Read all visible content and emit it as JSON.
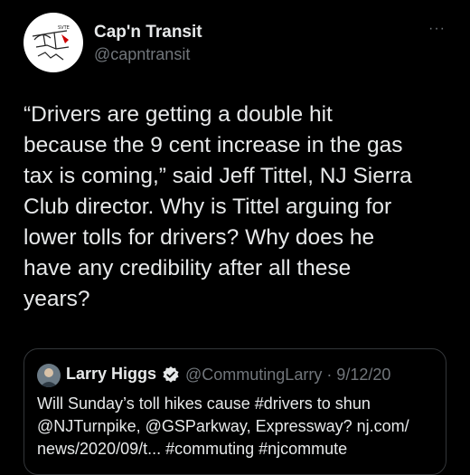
{
  "author": {
    "display_name": "Cap'n Transit",
    "handle": "@capntransit",
    "more_label": "···"
  },
  "tweet": {
    "text": "“Drivers are getting a double hit\nbecause the 9 cent increase in the gas\ntax is coming,” said Jeff Tittel, NJ Sierra\nClub director.  Why is Tittel arguing for\nlower tolls for drivers?  Why does he\nhave any credibility after all these\nyears?"
  },
  "quoted_tweet": {
    "display_name": "Larry Higgs",
    "handle_date": "@CommutingLarry · 9/12/20",
    "text": "Will Sunday’s  toll hikes cause #drivers to shun\n@NJTurnpike, @GSParkway, Expressway? nj.com/\nnews/2020/09/t... #commuting #njcommute",
    "verified_color": "#1d9bf0"
  }
}
